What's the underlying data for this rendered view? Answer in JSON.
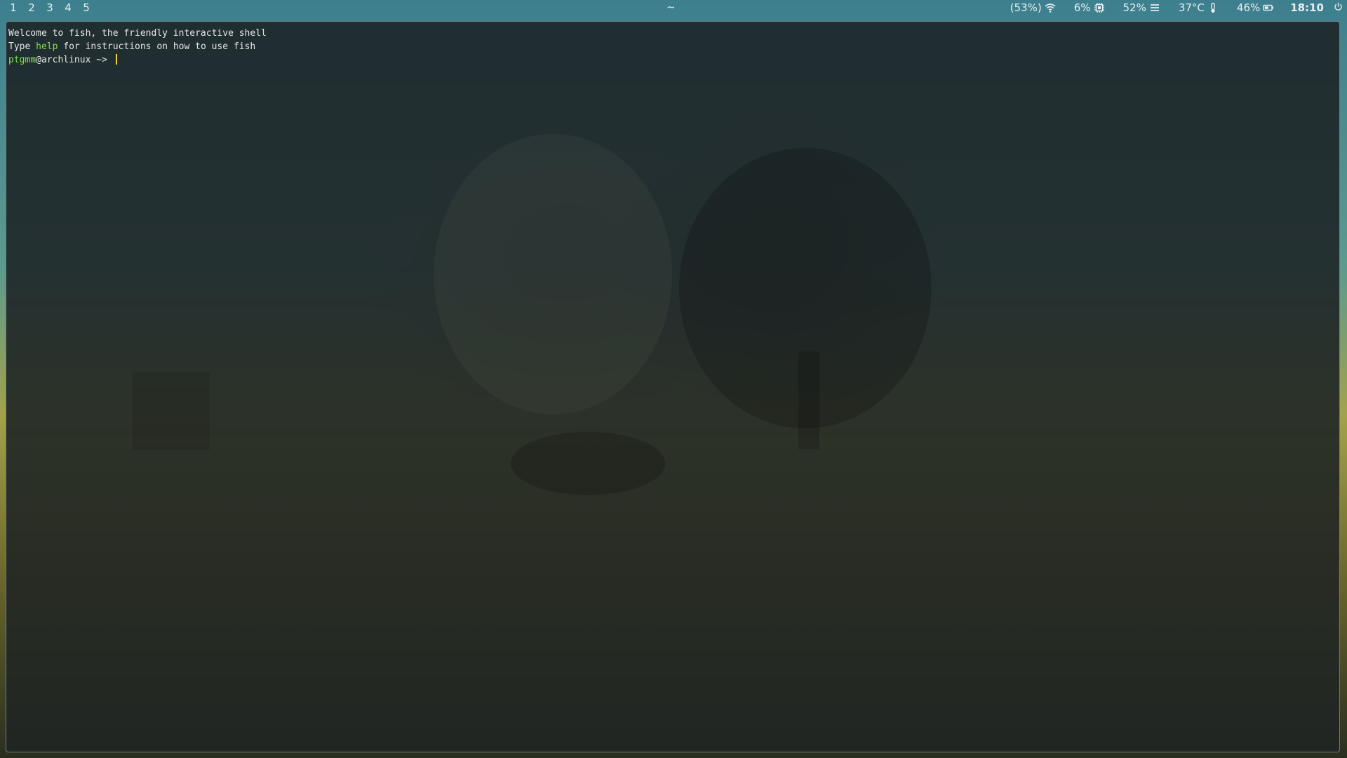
{
  "topbar": {
    "workspaces": [
      "1",
      "2",
      "3",
      "4",
      "5"
    ],
    "window_title": "~",
    "wifi": {
      "label": "(53%)",
      "icon": "wifi-icon"
    },
    "cpu": {
      "label": "6%",
      "icon": "cpu-icon"
    },
    "memory": {
      "label": "52%",
      "icon": "memory-icon"
    },
    "temperature": {
      "label": "37°C",
      "icon": "thermometer-icon"
    },
    "battery": {
      "label": "46%",
      "icon": "battery-icon"
    },
    "clock": "18:10",
    "power_icon": "power-icon"
  },
  "terminal": {
    "welcome_line": "Welcome to fish, the friendly interactive shell",
    "help_prefix": "Type ",
    "help_word": "help",
    "help_suffix": " for instructions on how to use fish",
    "prompt_user": "ptgmm",
    "prompt_host": "@archlinux",
    "prompt_arrow": " ~> "
  },
  "colors": {
    "accent_green": "#7ee24a",
    "cursor": "#f0d33a",
    "text": "#e6e6e6",
    "terminal_bg": "#1c2224"
  }
}
